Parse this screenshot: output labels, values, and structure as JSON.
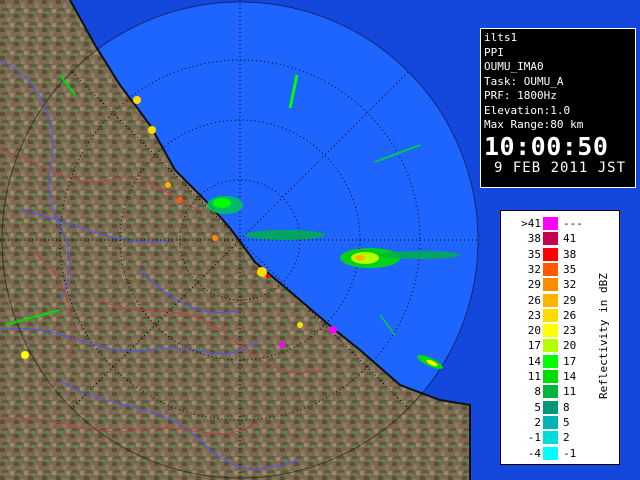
{
  "info": {
    "site": "ilts1",
    "scan_type": "PPI",
    "product": "OUMU_IMA0",
    "task": "Task: OUMU_A",
    "prf": "PRF: 1800Hz",
    "elevation": "Elevation:1.0",
    "max_range": "Max Range:80 km",
    "time": "10:00:50",
    "date": "9 FEB 2011 JST"
  },
  "legend": {
    "title": "Reflectivity in dBZ",
    "rows": [
      {
        "low": ">41",
        "high": "---",
        "color": "#ff00ff"
      },
      {
        "low": "38",
        "high": "41",
        "color": "#c80050"
      },
      {
        "low": "35",
        "high": "38",
        "color": "#ff0000"
      },
      {
        "low": "32",
        "high": "35",
        "color": "#ff5a00"
      },
      {
        "low": "29",
        "high": "32",
        "color": "#ff8c00"
      },
      {
        "low": "26",
        "high": "29",
        "color": "#ffb400"
      },
      {
        "low": "23",
        "high": "26",
        "color": "#ffdc00"
      },
      {
        "low": "20",
        "high": "23",
        "color": "#ffff00"
      },
      {
        "low": "17",
        "high": "20",
        "color": "#b4ff00"
      },
      {
        "low": "14",
        "high": "17",
        "color": "#00ff00"
      },
      {
        "low": "11",
        "high": "14",
        "color": "#00dc00"
      },
      {
        "low": "8",
        "high": "11",
        "color": "#00b43c"
      },
      {
        "low": "5",
        "high": "8",
        "color": "#009678"
      },
      {
        "low": "2",
        "high": "5",
        "color": "#00b4b4"
      },
      {
        "low": "-1",
        "high": "2",
        "color": "#00dcdc"
      },
      {
        "low": "-4",
        "high": "-1",
        "color": "#00ffff"
      }
    ]
  },
  "colors": {
    "sea": "#1e64ff",
    "sea_outer": "#1448dc",
    "land": "#7a6a52",
    "range_ring": "#000000"
  }
}
